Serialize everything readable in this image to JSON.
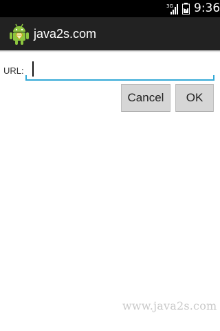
{
  "status_bar": {
    "network_label": "3G",
    "time": "9:36",
    "icons": [
      "signal-icon",
      "battery-icon"
    ]
  },
  "action_bar": {
    "title": "java2s.com",
    "icon": "android-robot-icon"
  },
  "form": {
    "url_label": "URL:",
    "url_value": "",
    "url_placeholder": "",
    "accent_color": "#33a9d6"
  },
  "buttons": {
    "cancel_label": "Cancel",
    "ok_label": "OK"
  },
  "watermark": "www.java2s.com"
}
